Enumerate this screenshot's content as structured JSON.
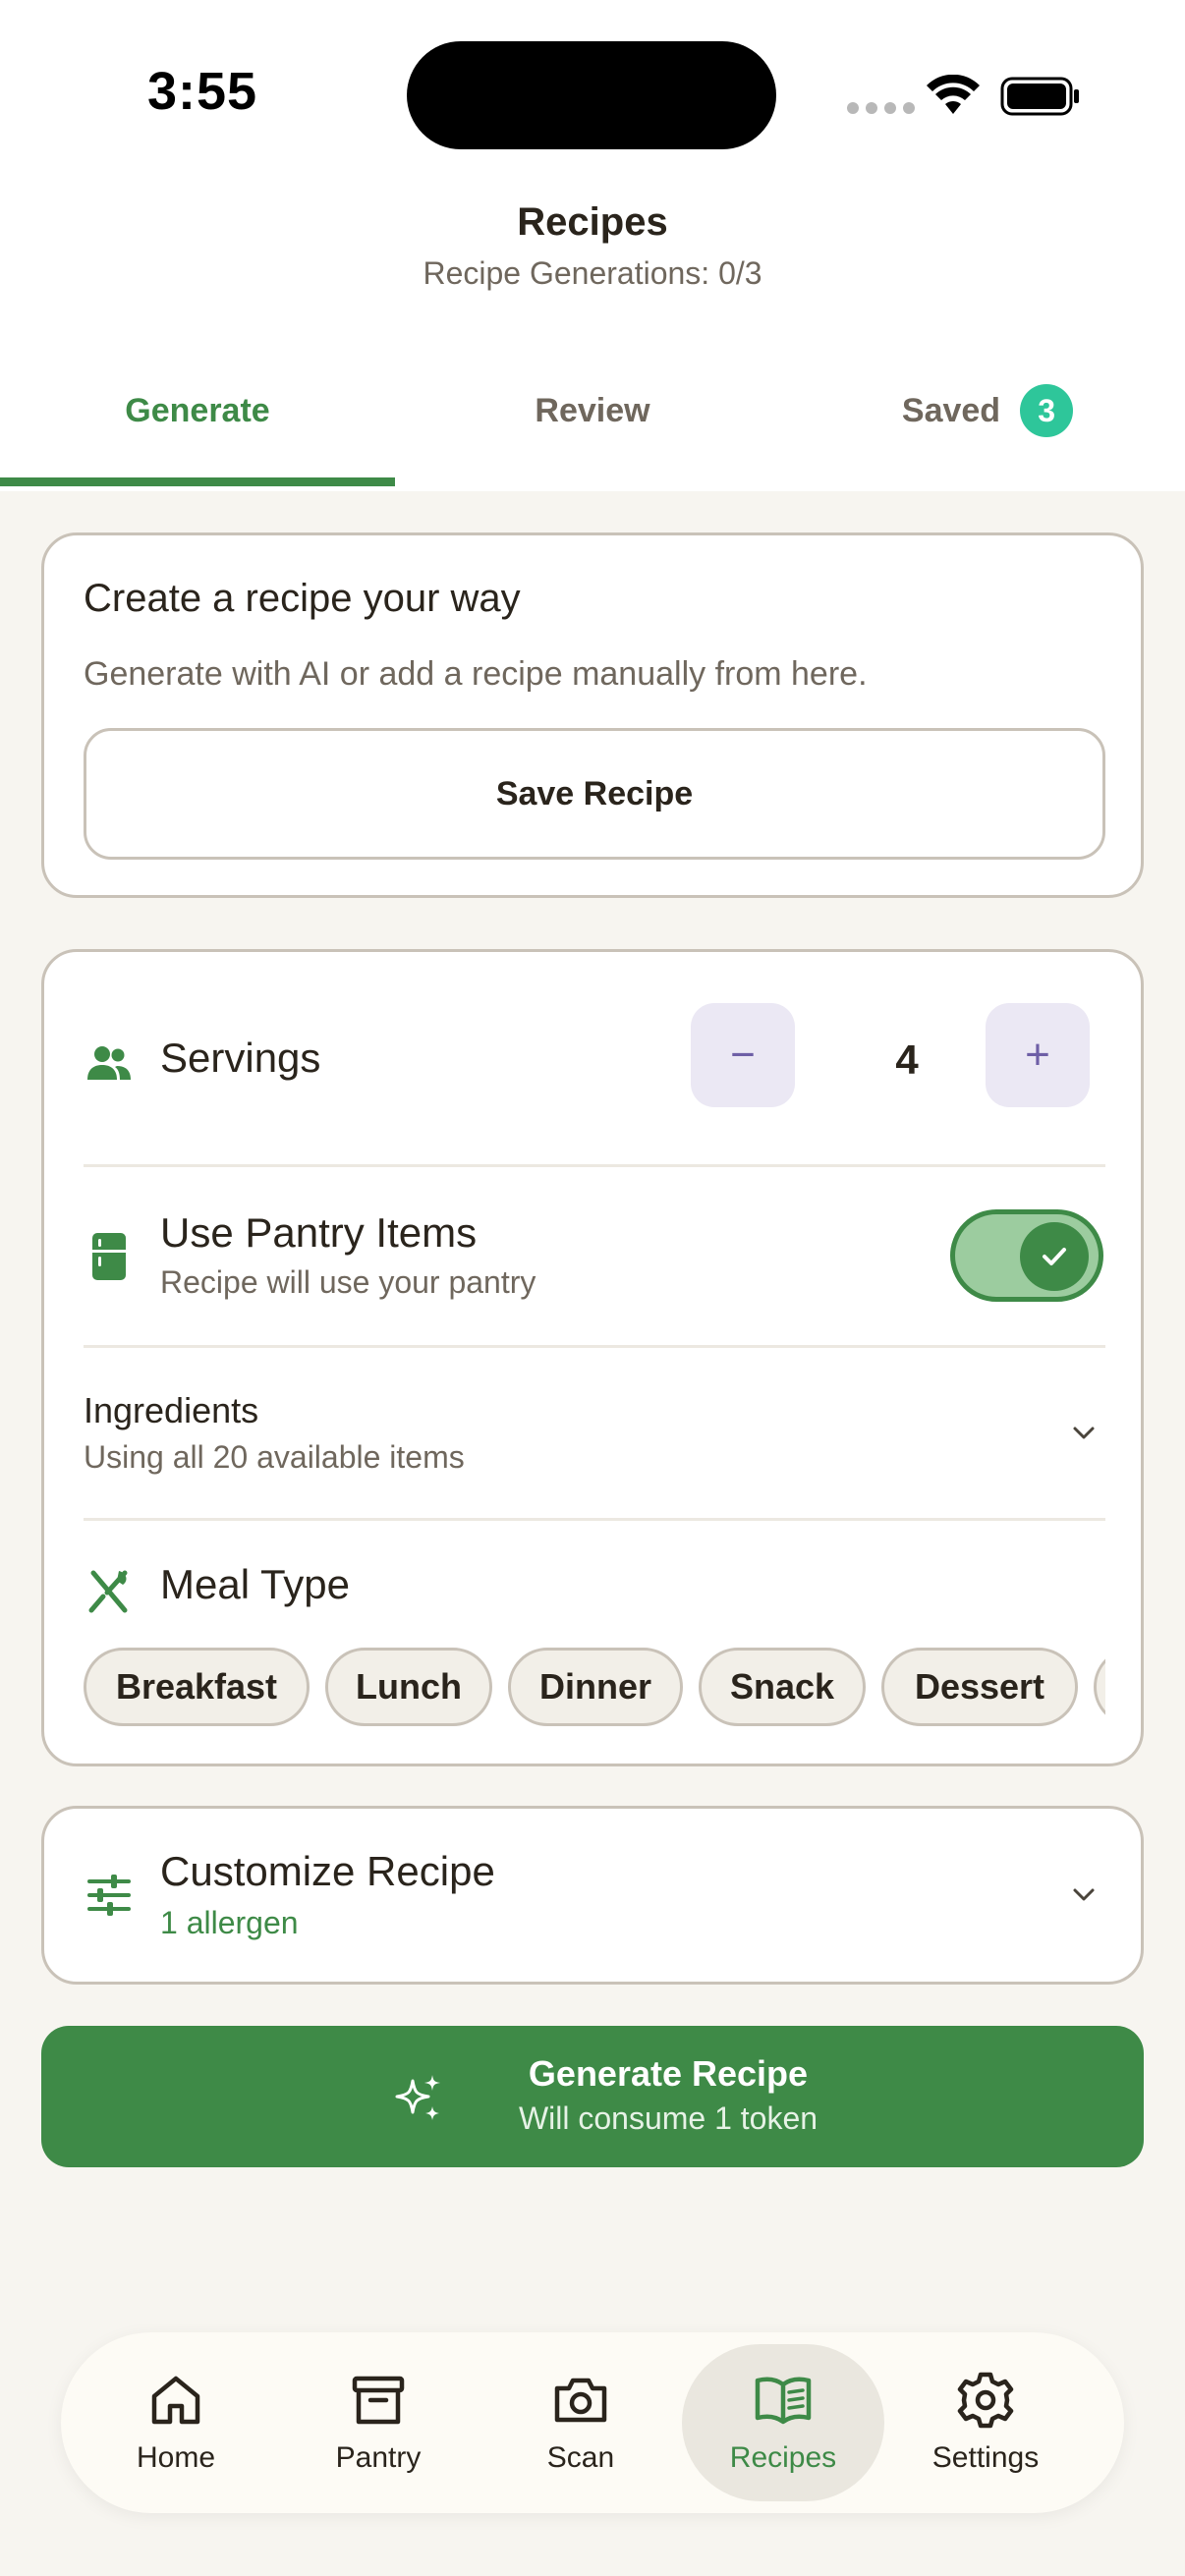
{
  "status_bar": {
    "time": "3:55"
  },
  "header": {
    "title": "Recipes",
    "subtitle": "Recipe Generations: 0/3"
  },
  "tabs": [
    {
      "label": "Generate",
      "active": true
    },
    {
      "label": "Review",
      "active": false
    },
    {
      "label": "Saved",
      "active": false,
      "badge": "3"
    }
  ],
  "create_card": {
    "title": "Create a recipe your way",
    "subtitle": "Generate with AI or add a recipe manually from here.",
    "button_label": "Save Recipe"
  },
  "options": {
    "servings": {
      "label": "Servings",
      "value": "4",
      "minus": "−",
      "plus": "+"
    },
    "pantry": {
      "label": "Use Pantry Items",
      "subtitle": "Recipe will use your pantry",
      "enabled": true
    },
    "ingredients": {
      "label": "Ingredients",
      "subtitle": "Using all 20 available items"
    },
    "meal_type": {
      "label": "Meal Type",
      "chips": [
        "Breakfast",
        "Lunch",
        "Dinner",
        "Snack",
        "Dessert"
      ]
    }
  },
  "customize": {
    "label": "Customize Recipe",
    "subtitle": "1 allergen"
  },
  "generate_button": {
    "title": "Generate Recipe",
    "subtitle": "Will consume 1 token"
  },
  "nav": [
    {
      "label": "Home",
      "icon": "home-icon"
    },
    {
      "label": "Pantry",
      "icon": "archive-icon"
    },
    {
      "label": "Scan",
      "icon": "camera-icon"
    },
    {
      "label": "Recipes",
      "icon": "book-icon",
      "active": true
    },
    {
      "label": "Settings",
      "icon": "gear-icon"
    }
  ],
  "colors": {
    "accent": "#3e8a47",
    "badge": "#2ec69a",
    "stepper": "#ebe8f4",
    "background": "#f7f5f0"
  }
}
